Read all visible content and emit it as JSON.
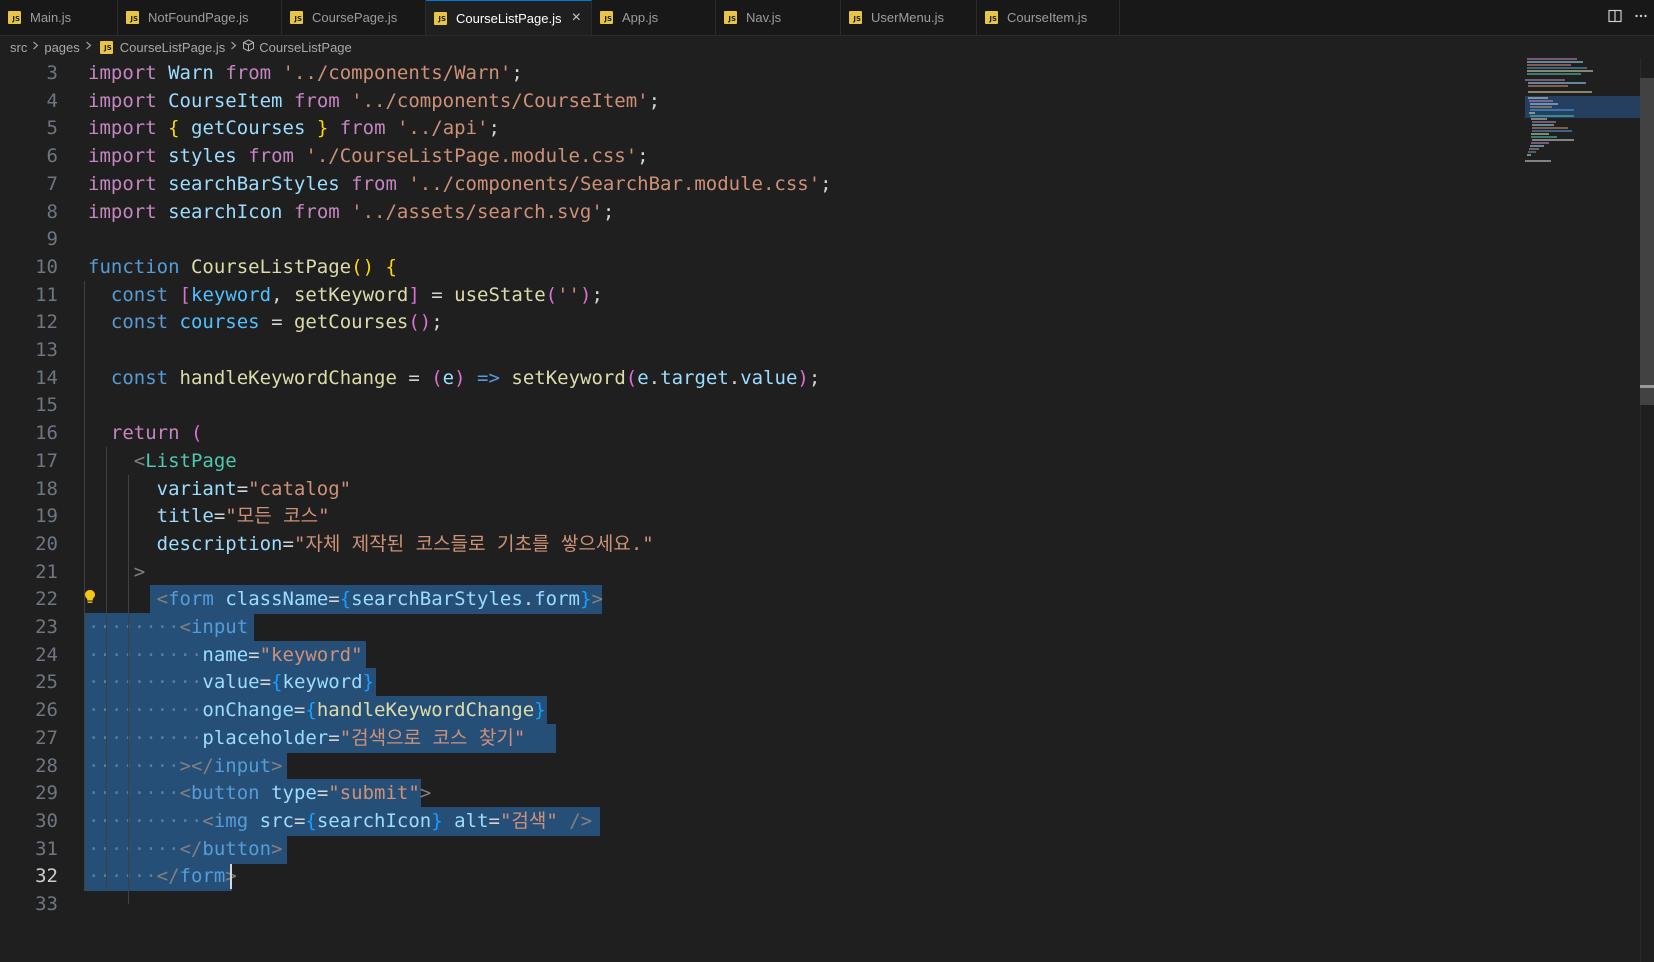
{
  "tabs": [
    {
      "label": "Main.js",
      "active": false
    },
    {
      "label": "NotFoundPage.js",
      "active": false
    },
    {
      "label": "CoursePage.js",
      "active": false
    },
    {
      "label": "CourseListPage.js",
      "active": true
    },
    {
      "label": "App.js",
      "active": false
    },
    {
      "label": "Nav.js",
      "active": false
    },
    {
      "label": "UserMenu.js",
      "active": false
    },
    {
      "label": "CourseItem.js",
      "active": false
    }
  ],
  "tab_icon_text": "JS",
  "tab_close_glyph": "×",
  "breadcrumb": {
    "root": "src",
    "folder": "pages",
    "file": "CourseListPage.js",
    "symbol": "CourseListPage"
  },
  "editor": {
    "line_numbers": [
      "3",
      "4",
      "5",
      "6",
      "7",
      "8",
      "9",
      "10",
      "11",
      "12",
      "13",
      "14",
      "15",
      "16",
      "17",
      "18",
      "19",
      "20",
      "21",
      "22",
      "23",
      "24",
      "25",
      "26",
      "27",
      "28",
      "29",
      "30",
      "31",
      "32",
      "33"
    ],
    "current_line": "32",
    "lines": [
      [
        [
          "import",
          "kw1"
        ],
        [
          " ",
          "pun"
        ],
        [
          "Warn",
          "var"
        ],
        [
          " ",
          "pun"
        ],
        [
          "from",
          "kw1"
        ],
        [
          " ",
          "pun"
        ],
        [
          "'../components/Warn'",
          "str"
        ],
        [
          ";",
          "pun"
        ]
      ],
      [
        [
          "import",
          "kw1"
        ],
        [
          " ",
          "pun"
        ],
        [
          "CourseItem",
          "var"
        ],
        [
          " ",
          "pun"
        ],
        [
          "from",
          "kw1"
        ],
        [
          " ",
          "pun"
        ],
        [
          "'../components/CourseItem'",
          "str"
        ],
        [
          ";",
          "pun"
        ]
      ],
      [
        [
          "import",
          "kw1"
        ],
        [
          " ",
          "pun"
        ],
        [
          "{",
          "br1"
        ],
        [
          " ",
          "pun"
        ],
        [
          "getCourses",
          "var"
        ],
        [
          " ",
          "pun"
        ],
        [
          "}",
          "br1"
        ],
        [
          " ",
          "pun"
        ],
        [
          "from",
          "kw1"
        ],
        [
          " ",
          "pun"
        ],
        [
          "'../api'",
          "str"
        ],
        [
          ";",
          "pun"
        ]
      ],
      [
        [
          "import",
          "kw1"
        ],
        [
          " ",
          "pun"
        ],
        [
          "styles",
          "var"
        ],
        [
          " ",
          "pun"
        ],
        [
          "from",
          "kw1"
        ],
        [
          " ",
          "pun"
        ],
        [
          "'./CourseListPage.module.css'",
          "str"
        ],
        [
          ";",
          "pun"
        ]
      ],
      [
        [
          "import",
          "kw1"
        ],
        [
          " ",
          "pun"
        ],
        [
          "searchBarStyles",
          "var"
        ],
        [
          " ",
          "pun"
        ],
        [
          "from",
          "kw1"
        ],
        [
          " ",
          "pun"
        ],
        [
          "'../components/SearchBar.module.css'",
          "str"
        ],
        [
          ";",
          "pun"
        ]
      ],
      [
        [
          "import",
          "kw1"
        ],
        [
          " ",
          "pun"
        ],
        [
          "searchIcon",
          "var"
        ],
        [
          " ",
          "pun"
        ],
        [
          "from",
          "kw1"
        ],
        [
          " ",
          "pun"
        ],
        [
          "'../assets/search.svg'",
          "str"
        ],
        [
          ";",
          "pun"
        ]
      ],
      [],
      [
        [
          "function",
          "kw2"
        ],
        [
          " ",
          "pun"
        ],
        [
          "CourseListPage",
          "fn"
        ],
        [
          "()",
          "br1"
        ],
        [
          " ",
          "pun"
        ],
        [
          "{",
          "br1"
        ]
      ],
      [
        [
          "  ",
          "pun"
        ],
        [
          "const",
          "kw2"
        ],
        [
          " ",
          "pun"
        ],
        [
          "[",
          "br2"
        ],
        [
          "keyword",
          "const"
        ],
        [
          ", ",
          "pun"
        ],
        [
          "setKeyword",
          "fn"
        ],
        [
          "]",
          "br2"
        ],
        [
          " = ",
          "pun"
        ],
        [
          "useState",
          "fn"
        ],
        [
          "(",
          "br2"
        ],
        [
          "''",
          "str"
        ],
        [
          ")",
          "br2"
        ],
        [
          ";",
          "pun"
        ]
      ],
      [
        [
          "  ",
          "pun"
        ],
        [
          "const",
          "kw2"
        ],
        [
          " ",
          "pun"
        ],
        [
          "courses",
          "const"
        ],
        [
          " = ",
          "pun"
        ],
        [
          "getCourses",
          "fn"
        ],
        [
          "()",
          "br2"
        ],
        [
          ";",
          "pun"
        ]
      ],
      [],
      [
        [
          "  ",
          "pun"
        ],
        [
          "const",
          "kw2"
        ],
        [
          " ",
          "pun"
        ],
        [
          "handleKeywordChange",
          "fn"
        ],
        [
          " = ",
          "pun"
        ],
        [
          "(",
          "br2"
        ],
        [
          "e",
          "var"
        ],
        [
          ")",
          "br2"
        ],
        [
          " ",
          "pun"
        ],
        [
          "=>",
          "kw2"
        ],
        [
          " ",
          "pun"
        ],
        [
          "setKeyword",
          "fn"
        ],
        [
          "(",
          "br2"
        ],
        [
          "e",
          "var"
        ],
        [
          ".",
          "pun"
        ],
        [
          "target",
          "var"
        ],
        [
          ".",
          "pun"
        ],
        [
          "value",
          "var"
        ],
        [
          ")",
          "br2"
        ],
        [
          ";",
          "pun"
        ]
      ],
      [],
      [
        [
          "  ",
          "pun"
        ],
        [
          "return",
          "kw1"
        ],
        [
          " ",
          "pun"
        ],
        [
          "(",
          "br2"
        ]
      ],
      [
        [
          "    ",
          "pun"
        ],
        [
          "<",
          "tagp"
        ],
        [
          "ListPage",
          "cls"
        ]
      ],
      [
        [
          "      ",
          "pun"
        ],
        [
          "variant",
          "var"
        ],
        [
          "=",
          "pun"
        ],
        [
          "\"catalog\"",
          "str"
        ]
      ],
      [
        [
          "      ",
          "pun"
        ],
        [
          "title",
          "var"
        ],
        [
          "=",
          "pun"
        ],
        [
          "\"모든 코스\"",
          "str"
        ]
      ],
      [
        [
          "      ",
          "pun"
        ],
        [
          "description",
          "var"
        ],
        [
          "=",
          "pun"
        ],
        [
          "\"자체 제작된 코스들로 기초를 쌓으세요.\"",
          "str"
        ]
      ],
      [
        [
          "    ",
          "pun"
        ],
        [
          ">",
          "tagp"
        ]
      ],
      [
        [
          "      ",
          "pun"
        ],
        [
          "<",
          "tagp"
        ],
        [
          "form",
          "kw2"
        ],
        [
          " ",
          "pun"
        ],
        [
          "className",
          "var"
        ],
        [
          "=",
          "pun"
        ],
        [
          "{",
          "br3"
        ],
        [
          "searchBarStyles",
          "var"
        ],
        [
          ".",
          "pun"
        ],
        [
          "form",
          "var"
        ],
        [
          "}",
          "br3"
        ],
        [
          ">",
          "tagp"
        ]
      ],
      [
        [
          "········",
          "ws"
        ],
        [
          "<",
          "tagp"
        ],
        [
          "input",
          "kw2"
        ]
      ],
      [
        [
          "··········",
          "ws"
        ],
        [
          "name",
          "var"
        ],
        [
          "=",
          "pun"
        ],
        [
          "\"keyword\"",
          "str"
        ]
      ],
      [
        [
          "··········",
          "ws"
        ],
        [
          "value",
          "var"
        ],
        [
          "=",
          "pun"
        ],
        [
          "{",
          "br3"
        ],
        [
          "keyword",
          "var"
        ],
        [
          "}",
          "br3"
        ]
      ],
      [
        [
          "··········",
          "ws"
        ],
        [
          "onChange",
          "var"
        ],
        [
          "=",
          "pun"
        ],
        [
          "{",
          "br3"
        ],
        [
          "handleKeywordChange",
          "fn"
        ],
        [
          "}",
          "br3"
        ]
      ],
      [
        [
          "··········",
          "ws"
        ],
        [
          "placeholder",
          "var"
        ],
        [
          "=",
          "pun"
        ],
        [
          "\"검색으로 코스 찾기\"",
          "str"
        ]
      ],
      [
        [
          "········",
          "ws"
        ],
        [
          "></",
          "tagp"
        ],
        [
          "input",
          "kw2"
        ],
        [
          ">",
          "tagp"
        ]
      ],
      [
        [
          "········",
          "ws"
        ],
        [
          "<",
          "tagp"
        ],
        [
          "button",
          "kw2"
        ],
        [
          " ",
          "pun"
        ],
        [
          "type",
          "var"
        ],
        [
          "=",
          "pun"
        ],
        [
          "\"submit\"",
          "str"
        ],
        [
          ">",
          "tagp"
        ]
      ],
      [
        [
          "··········",
          "ws"
        ],
        [
          "<",
          "tagp"
        ],
        [
          "img",
          "kw2"
        ],
        [
          " ",
          "pun"
        ],
        [
          "src",
          "var"
        ],
        [
          "=",
          "pun"
        ],
        [
          "{",
          "br3"
        ],
        [
          "searchIcon",
          "var"
        ],
        [
          "}",
          "br3"
        ],
        [
          " ",
          "pun"
        ],
        [
          "alt",
          "var"
        ],
        [
          "=",
          "pun"
        ],
        [
          "\"검색\"",
          "str"
        ],
        [
          " ",
          "pun"
        ],
        [
          "/>",
          "tagp"
        ]
      ],
      [
        [
          "········",
          "ws"
        ],
        [
          "</",
          "tagp"
        ],
        [
          "button",
          "kw2"
        ],
        [
          ">",
          "tagp"
        ]
      ],
      [
        [
          "······",
          "ws"
        ],
        [
          "</",
          "tagp"
        ],
        [
          "form",
          "kw2"
        ],
        [
          ">",
          "tagp"
        ]
      ],
      []
    ]
  }
}
